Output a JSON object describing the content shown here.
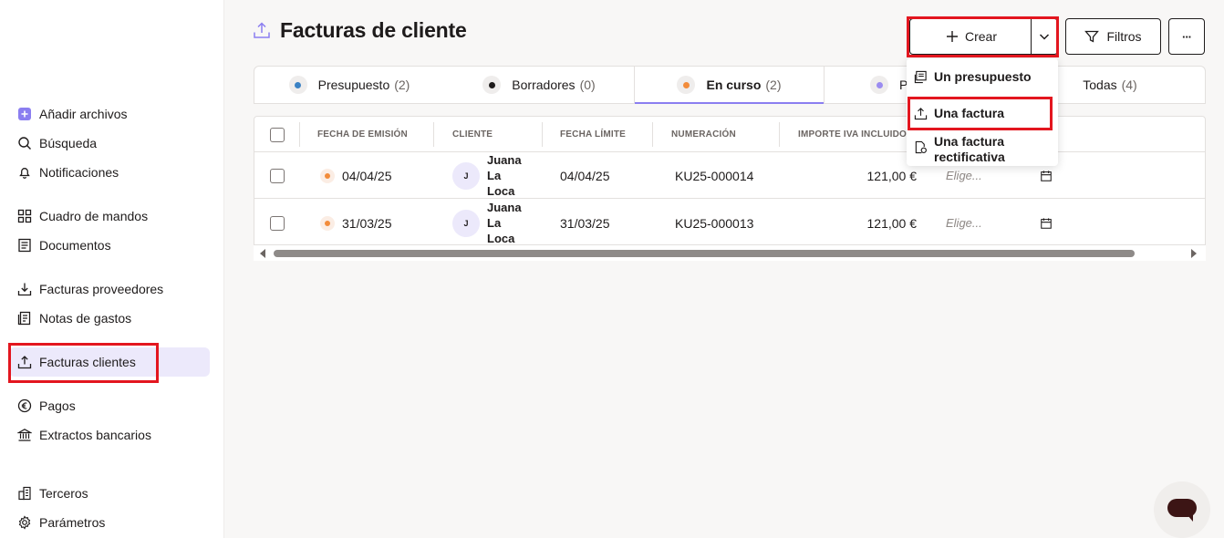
{
  "sidebar": {
    "items": [
      {
        "label": "Añadir archivos",
        "icon": "plus-square-icon"
      },
      {
        "label": "Búsqueda",
        "icon": "search-icon"
      },
      {
        "label": "Notificaciones",
        "icon": "bell-icon"
      },
      {
        "label": "Cuadro de mandos",
        "icon": "dashboard-icon"
      },
      {
        "label": "Documentos",
        "icon": "document-icon"
      },
      {
        "label": "Facturas proveedores",
        "icon": "download-tray-icon"
      },
      {
        "label": "Notas de gastos",
        "icon": "receipt-icon"
      },
      {
        "label": "Facturas clientes",
        "icon": "upload-tray-icon"
      },
      {
        "label": "Pagos",
        "icon": "euro-circle-icon"
      },
      {
        "label": "Extractos bancarios",
        "icon": "bank-icon"
      },
      {
        "label": "Terceros",
        "icon": "buildings-icon"
      },
      {
        "label": "Parámetros",
        "icon": "gear-icon"
      }
    ],
    "active_item": "Facturas clientes"
  },
  "header": {
    "title": "Facturas de cliente",
    "create_label": "Crear",
    "filters_label": "Filtros",
    "more_label": "···"
  },
  "tabs": [
    {
      "label": "Presupuesto",
      "count": "(2)",
      "dot_color": "#3b82c4"
    },
    {
      "label": "Borradores",
      "count": "(0)",
      "dot_color": "#1e1b1b"
    },
    {
      "label": "En curso",
      "count": "(2)",
      "dot_color": "#f28c3b"
    },
    {
      "label": "P",
      "count": "",
      "dot_color": "#9b8cf0"
    },
    {
      "label": "Todas",
      "count": "(4)",
      "dot_color": ""
    }
  ],
  "table": {
    "columns": [
      "FECHA DE EMISIÓN",
      "CLIENTE",
      "FECHA LÍMITE",
      "NUMERACIÓN",
      "IMPORTE IVA INCLUIDO"
    ],
    "rows": [
      {
        "issue_date": "04/04/25",
        "client_initial": "J",
        "client_lines": [
          "Juana",
          "La",
          "Loca"
        ],
        "due_date": "04/04/25",
        "number": "KU25-000014",
        "amount": "121,00 €",
        "choose": "Elige...",
        "status_color": "#f28c3b"
      },
      {
        "issue_date": "31/03/25",
        "client_initial": "J",
        "client_lines": [
          "Juana",
          "La",
          "Loca"
        ],
        "due_date": "31/03/25",
        "number": "KU25-000013",
        "amount": "121,00 €",
        "choose": "Elige...",
        "status_color": "#f28c3b"
      }
    ]
  },
  "dropdown": {
    "items": [
      {
        "label": "Un presupuesto",
        "icon": "quote-icon"
      },
      {
        "label": "Una factura",
        "icon": "upload-tray-icon"
      },
      {
        "label_lines": [
          "Una factura",
          "rectificativa"
        ],
        "icon": "document-refresh-icon"
      }
    ]
  },
  "colors": {
    "accent": "#8b7ef0",
    "highlight": "#e3161f",
    "active_bg": "#ece9fb"
  }
}
